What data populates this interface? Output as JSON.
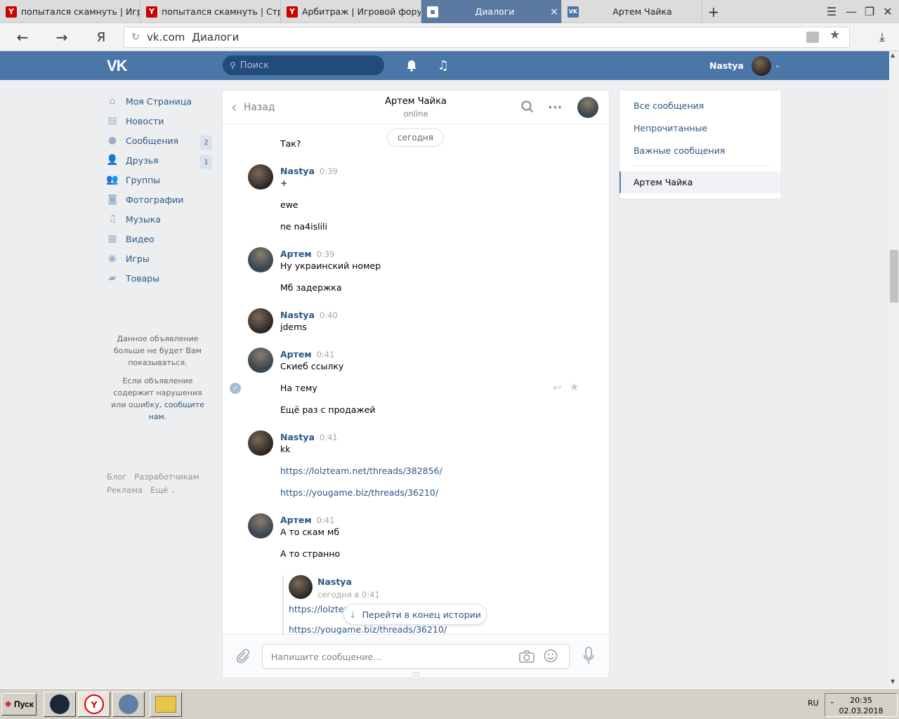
{
  "browser": {
    "tabs": [
      {
        "title": "попытался скамнуть | Игровой форум",
        "icon": "yandex"
      },
      {
        "title": "попытался скамнуть | Страница",
        "icon": "yandex"
      },
      {
        "title": "Арбитраж | Игровой форум",
        "icon": "yandex"
      },
      {
        "title": "Диалоги",
        "icon": "dialogs",
        "active": true
      },
      {
        "title": "Артем Чайка",
        "icon": "vk"
      }
    ],
    "url_domain": "vk.com",
    "url_title": "Диалоги",
    "yandex_glyph": "Я"
  },
  "header": {
    "search_placeholder": "Поиск",
    "user_name": "Nastya"
  },
  "menu": [
    {
      "label": "Моя Страница",
      "icon": "home-icon"
    },
    {
      "label": "Новости",
      "icon": "news-icon"
    },
    {
      "label": "Сообщения",
      "icon": "messages-icon",
      "count": "2"
    },
    {
      "label": "Друзья",
      "icon": "friends-icon",
      "count": "1"
    },
    {
      "label": "Группы",
      "icon": "groups-icon"
    },
    {
      "label": "Фотографии",
      "icon": "photos-icon"
    },
    {
      "label": "Музыка",
      "icon": "music-icon"
    },
    {
      "label": "Видео",
      "icon": "video-icon"
    },
    {
      "label": "Игры",
      "icon": "games-icon"
    },
    {
      "label": "Товары",
      "icon": "market-icon"
    }
  ],
  "ad": {
    "hidden_line1": "Данное объявление",
    "hidden_line2": "больше не будет Вам",
    "hidden_line3": "показываться.",
    "report_line1": "Если объявление",
    "report_line2": "содержит нарушения",
    "report_line3": "или ошибку,",
    "report_link": "сообщите",
    "report_link2": "нам."
  },
  "footer": {
    "blog": "Блог",
    "dev": "Разработчикам",
    "ads": "Реклама",
    "more": "Ещё"
  },
  "chat": {
    "back_label": "Назад",
    "contact_name": "Артем Чайка",
    "contact_status": "online",
    "date_pill": "сегодня",
    "messages": [
      {
        "text": "Так?"
      },
      {
        "author": "Nastya",
        "time": "0:39",
        "lines": [
          "+",
          "ewe",
          "ne na4islili"
        ]
      },
      {
        "author": "Артем",
        "time": "0:39",
        "lines": [
          "Ну украинский номер",
          "Мб задержка"
        ]
      },
      {
        "author": "Nastya",
        "time": "0:40",
        "lines": [
          "jdems"
        ]
      },
      {
        "author": "Артем",
        "time": "0:41",
        "lines": [
          "Скиеб ссылку",
          "На тему",
          "Ещё раз с продажей"
        ]
      },
      {
        "author": "Nastya",
        "time": "0:41",
        "lines": [
          "kk",
          "https://lolzteam.net/threads/382856/",
          "https://yougame.biz/threads/36210/"
        ]
      },
      {
        "author": "Артем",
        "time": "0:41",
        "lines": [
          "А то скам мб",
          "А то странно"
        ]
      }
    ],
    "forwarded": {
      "author": "Nastya",
      "time": "сегодня в 0:41",
      "line1": "https://lolzteam",
      "line2": "https://yougame.biz/threads/36210/"
    },
    "goto_end": "Перейти в конец истории",
    "input_placeholder": "Напишите сообщение..."
  },
  "right": {
    "all": "Все сообщения",
    "unread": "Непрочитанные",
    "important": "Важные сообщения",
    "selected": "Артем Чайка"
  },
  "taskbar": {
    "start": "Пуск",
    "lang": "RU",
    "time": "20:35",
    "date": "02.03.2018"
  },
  "colors": {
    "vk_blue": "#4a76a8",
    "link": "#2a5885",
    "tab_active": "#5b7aa3"
  }
}
